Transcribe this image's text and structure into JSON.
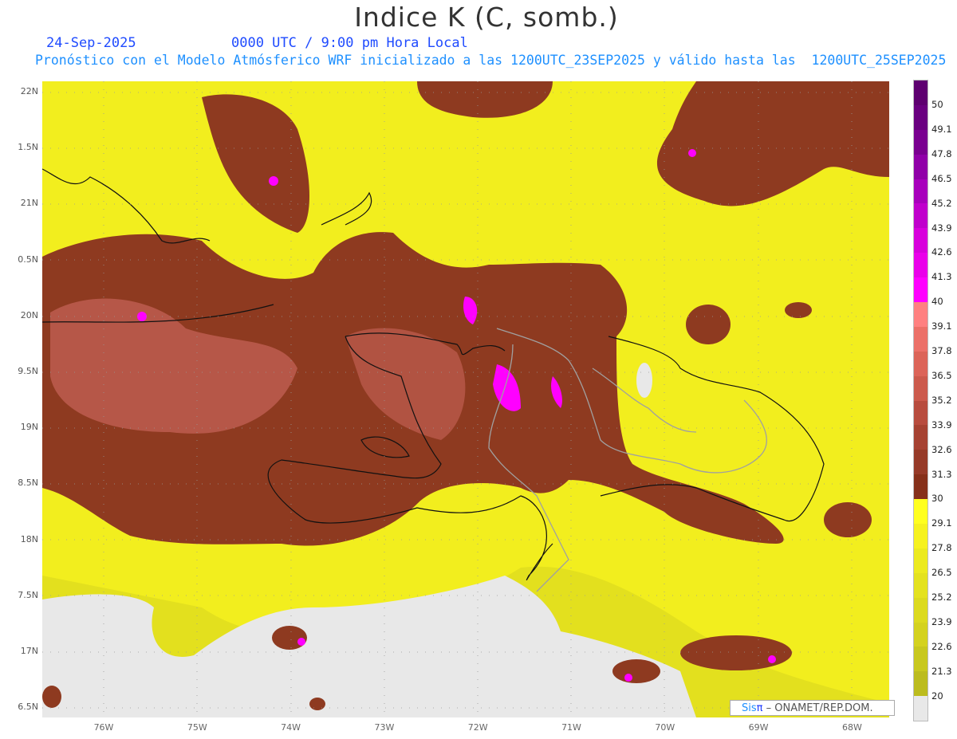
{
  "title": "Indice K (C, somb.)",
  "date": "24-Sep-2025",
  "time": "0000 UTC / 9:00 pm Hora Local",
  "subtitle": "Pronóstico con el Modelo Atmósferico WRF inicializado a las 1200UTC_23SEP2025 y válido hasta las  1200UTC_25SEP2025",
  "lat_labels": [
    "22N",
    "1.5N",
    "21N",
    "0.5N",
    "20N",
    "9.5N",
    "19N",
    "8.5N",
    "18N",
    "7.5N",
    "17N",
    "6.5N"
  ],
  "lon_labels": [
    "76W",
    "75W",
    "74W",
    "73W",
    "72W",
    "71W",
    "70W",
    "69W",
    "68W"
  ],
  "colorbar": {
    "labels": [
      "50",
      "49.1",
      "47.8",
      "46.5",
      "45.2",
      "43.9",
      "42.6",
      "41.3",
      "40",
      "39.1",
      "37.8",
      "36.5",
      "35.2",
      "33.9",
      "32.6",
      "31.3",
      "30",
      "29.1",
      "27.8",
      "26.5",
      "25.2",
      "23.9",
      "22.6",
      "21.3",
      "20"
    ],
    "colors": [
      "#5e0070",
      "#6a0080",
      "#7a0090",
      "#9000a8",
      "#a800bc",
      "#c000cc",
      "#d800dc",
      "#ea00ea",
      "#ff00ff",
      "#ff8080",
      "#ec7068",
      "#dc6458",
      "#cc5a4c",
      "#b84c3e",
      "#a64232",
      "#963a28",
      "#86301a",
      "#ffff1e",
      "#f6f21e",
      "#ecea1e",
      "#e4e21e",
      "#dcda1e",
      "#d4d21e",
      "#c8c81e",
      "#bcbc1e",
      "#e8e8e8"
    ]
  },
  "credit": {
    "brand_a": "Sis",
    "brand_b": "π",
    "text": " –  ONAMET/REP.DOM."
  }
}
